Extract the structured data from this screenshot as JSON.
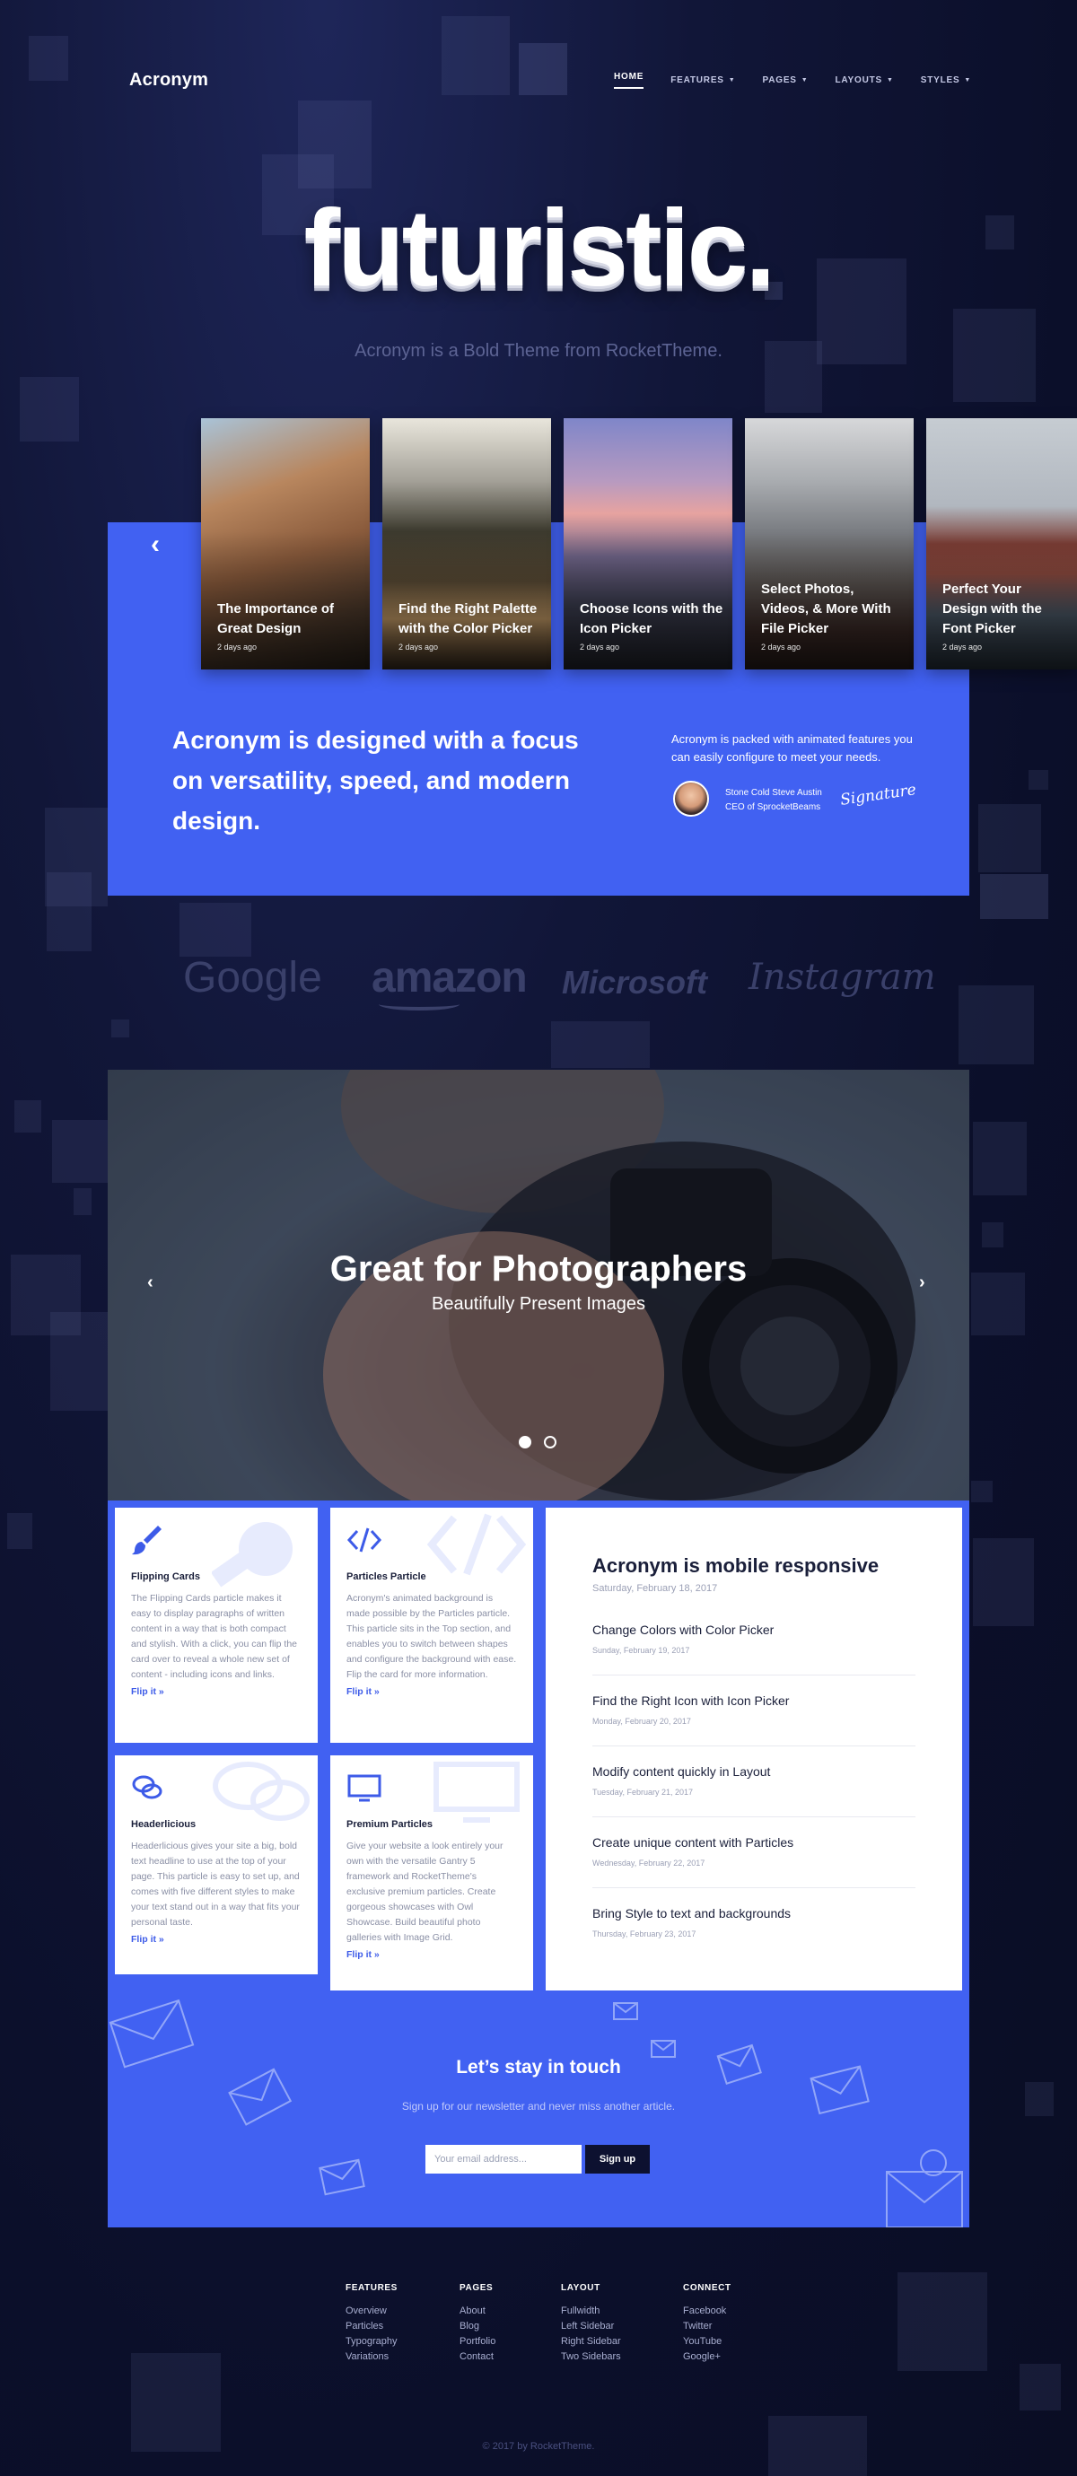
{
  "header": {
    "logo": "Acronym",
    "nav": [
      {
        "label": "HOME",
        "active": true,
        "caret": false
      },
      {
        "label": "FEATURES",
        "active": false,
        "caret": true
      },
      {
        "label": "PAGES",
        "active": false,
        "caret": true
      },
      {
        "label": "LAYOUTS",
        "active": false,
        "caret": true
      },
      {
        "label": "STYLES",
        "active": false,
        "caret": true
      }
    ]
  },
  "hero": {
    "title": "futuristic.",
    "subtitle": "Acronym is a Bold Theme from RocketTheme."
  },
  "cards": [
    {
      "title": "The Importance of Great Design",
      "date": "2 days ago",
      "icon": "half-dome-photo"
    },
    {
      "title": "Find the Right Palette with the Color Picker",
      "date": "2 days ago",
      "icon": "forest-road-photo"
    },
    {
      "title": "Choose Icons with the Icon Picker",
      "date": "2 days ago",
      "icon": "valley-dusk-photo"
    },
    {
      "title": "Select Photos, Videos, & More With File Picker",
      "date": "2 days ago",
      "icon": "misty-cliff-photo"
    },
    {
      "title": "Perfect Your Design with the Font Picker",
      "date": "2 days ago",
      "icon": "hiker-sea-photo"
    }
  ],
  "feature_panel": {
    "heading": "Acronym is designed with a focus on versatility, speed, and modern design.",
    "text": "Acronym is packed with animated features you can easily configure to meet your needs.",
    "author_name": "Stone Cold Steve Austin",
    "author_role": "CEO of SprocketBeams",
    "signature": "Signature"
  },
  "brands": [
    "Google",
    "amazon",
    "Microsoft",
    "Instagram"
  ],
  "slider": {
    "title": "Great for Photographers",
    "subtitle": "Beautifully Present Images",
    "active_slide": 1,
    "total_slides": 2
  },
  "features": [
    {
      "title": "Flipping Cards",
      "text": "The Flipping Cards particle makes it easy to display paragraphs of written content in a way that is both compact and stylish. With a click, you can flip the card over to reveal a whole new set of content - including icons and links.",
      "link": "Flip it »",
      "icon": "paint-brush-icon"
    },
    {
      "title": "Particles Particle",
      "text": "Acronym's animated background is made possible by the Particles particle. This particle sits in the Top section, and enables you to switch between shapes and configure the background with ease. Flip the card for more information.",
      "link": "Flip it »",
      "icon": "code-icon"
    },
    {
      "title": "Headerlicious",
      "text": "Headerlicious gives your site a big, bold text headline to use at the top of your page. This particle is easy to set up, and comes with five different styles to make your text stand out in a way that fits your personal taste.",
      "link": "Flip it »",
      "icon": "chat-bubbles-icon"
    },
    {
      "title": "Premium Particles",
      "text": "Give your website a look entirely your own with the versatile Gantry 5 framework and RocketTheme's exclusive premium particles. Create gorgeous showcases with Owl Showcase. Build beautiful photo galleries with Image Grid.",
      "link": "Flip it »",
      "icon": "monitor-icon"
    }
  ],
  "news": {
    "title": "Acronym is mobile responsive",
    "date": "Saturday, February 18, 2017",
    "items": [
      {
        "title": "Change Colors with Color Picker",
        "date": "Sunday, February 19, 2017"
      },
      {
        "title": "Find the Right Icon with Icon Picker",
        "date": "Monday, February 20, 2017"
      },
      {
        "title": "Modify content quickly in Layout",
        "date": "Tuesday, February 21, 2017"
      },
      {
        "title": "Create unique content with Particles",
        "date": "Wednesday, February 22, 2017"
      },
      {
        "title": "Bring Style to text and backgrounds",
        "date": "Thursday, February 23, 2017"
      }
    ]
  },
  "newsletter": {
    "title": "Let’s stay in touch",
    "subtitle": "Sign up for our newsletter and never miss another article.",
    "placeholder": "Your email address...",
    "button": "Sign up"
  },
  "footer": {
    "columns": [
      {
        "title": "FEATURES",
        "links": [
          "Overview",
          "Particles",
          "Typography",
          "Variations"
        ]
      },
      {
        "title": "PAGES",
        "links": [
          "About",
          "Blog",
          "Portfolio",
          "Contact"
        ]
      },
      {
        "title": "LAYOUT",
        "links": [
          "Fullwidth",
          "Left Sidebar",
          "Right Sidebar",
          "Two Sidebars"
        ]
      },
      {
        "title": "CONNECT",
        "links": [
          "Facebook",
          "Twitter",
          "YouTube",
          "Google+"
        ]
      }
    ],
    "copyright": "© 2017 by RocketTheme."
  },
  "colors": {
    "brand_blue": "#4161f2",
    "page_dark": "#0b0f2a",
    "button_dark": "#0d1130",
    "link_blue": "#3d5be8"
  }
}
